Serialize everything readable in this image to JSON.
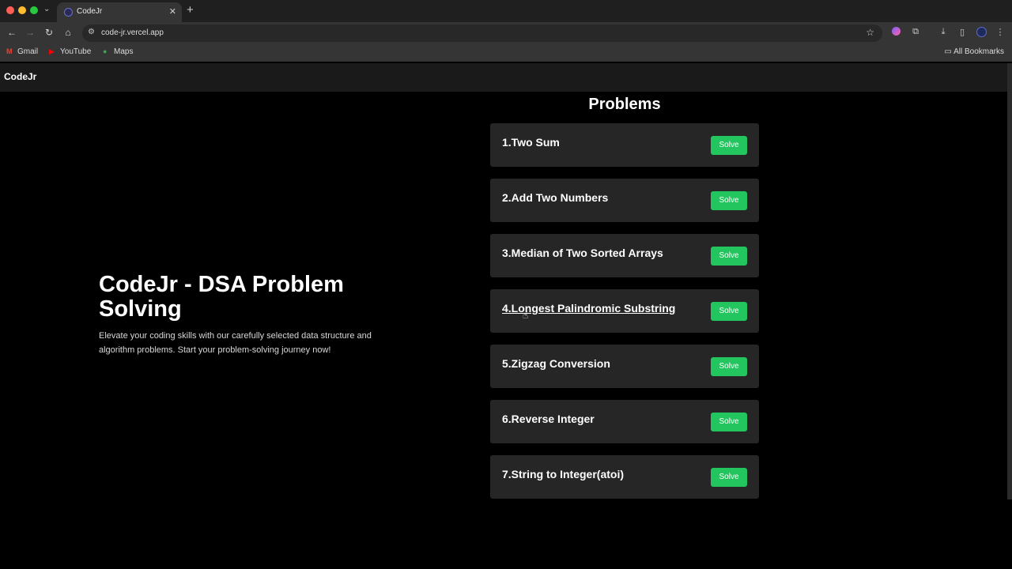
{
  "browser": {
    "tab_title": "CodeJr",
    "tab_close": "✕",
    "new_tab": "+",
    "url": "code-jr.vercel.app",
    "bookmarks": [
      {
        "label": "Gmail"
      },
      {
        "label": "YouTube"
      },
      {
        "label": "Maps"
      }
    ],
    "all_bookmarks": "All Bookmarks"
  },
  "site": {
    "brand": "CodeJr",
    "hero_title": "CodeJr - DSA Problem Solving",
    "hero_description": "Elevate your coding skills with our carefully selected data structure and algorithm problems. Start your problem-solving journey now!",
    "problems_heading": "Problems",
    "problems": [
      {
        "title": "1.Two Sum",
        "button": "Solve"
      },
      {
        "title": "2.Add Two Numbers",
        "button": "Solve"
      },
      {
        "title": "3.Median of Two Sorted Arrays",
        "button": "Solve"
      },
      {
        "title": "4.Longest Palindromic Substring",
        "button": "Solve"
      },
      {
        "title": "5.Zigzag Conversion",
        "button": "Solve"
      },
      {
        "title": "6.Reverse Integer",
        "button": "Solve"
      },
      {
        "title": "7.String to Integer(atoi)",
        "button": "Solve"
      }
    ]
  },
  "colors": {
    "solve_button": "#22c55e",
    "card_background": "#262626",
    "page_background": "#000000"
  }
}
